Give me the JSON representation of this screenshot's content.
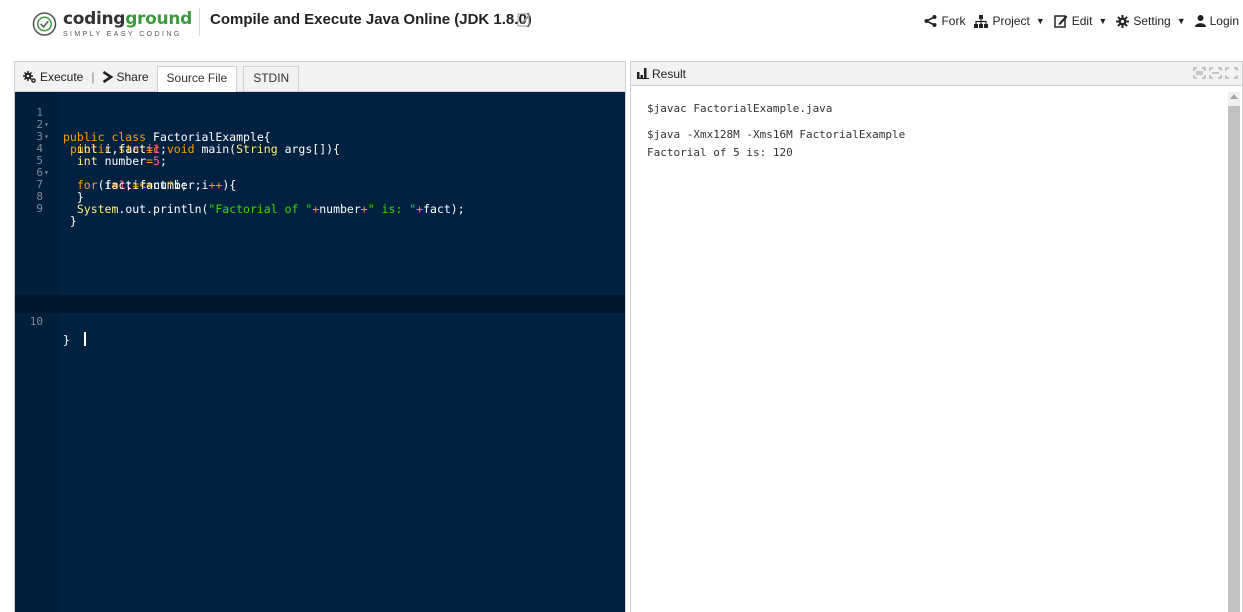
{
  "header": {
    "logo_name_part1": "coding",
    "logo_name_part2": "ground",
    "logo_tagline": "SIMPLY EASY CODING",
    "title": "Compile and Execute Java Online (JDK 1.8.0)",
    "nav": {
      "fork": "Fork",
      "project": "Project",
      "edit": "Edit",
      "setting": "Setting",
      "login": "Login"
    }
  },
  "toolbar": {
    "execute": "Execute",
    "separator": "|",
    "share": "Share",
    "tabs": [
      "Source File",
      "STDIN"
    ]
  },
  "editor": {
    "line_numbers": [
      "1",
      "2",
      "3",
      "4",
      "5",
      "6",
      "7",
      "8",
      "9",
      "10"
    ],
    "current_line": 10
  },
  "result": {
    "title": "Result",
    "lines": [
      "$javac FactorialExample.java",
      "$java -Xmx128M -Xms16M FactorialExample",
      "Factorial of 5 is: 120"
    ]
  },
  "colors": {
    "editor_bg": "#002240",
    "keyword": "#ff9d00",
    "type": "#ffee80",
    "string": "#3ad900",
    "number": "#ff628c",
    "brand_green": "#3e9a3e"
  }
}
